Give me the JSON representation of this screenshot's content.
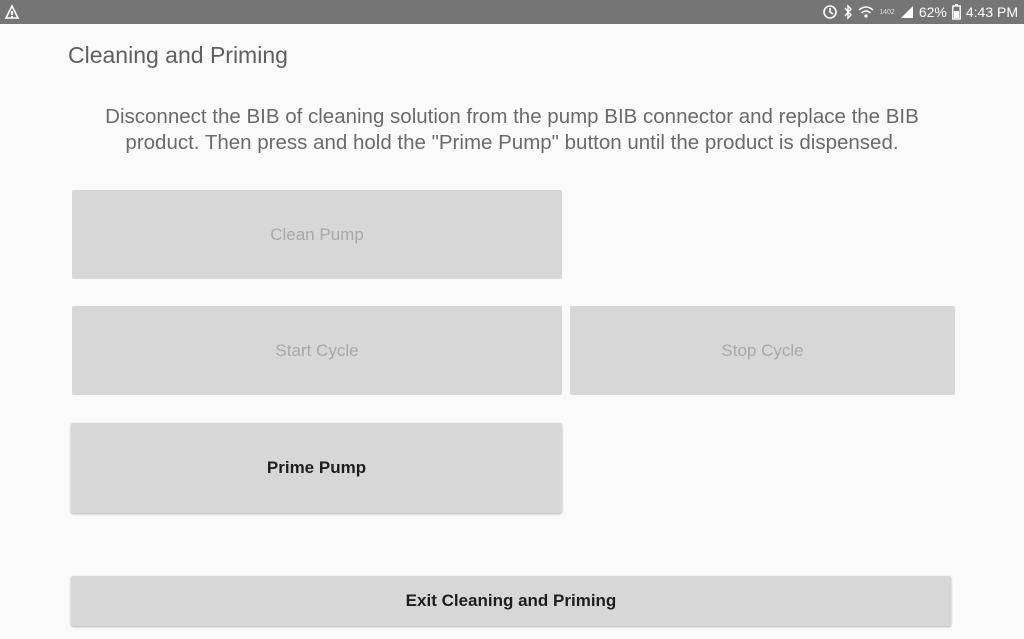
{
  "status_bar": {
    "left_icon": "notification-icon",
    "icons": [
      "sync-icon",
      "bluetooth-icon",
      "wifi-icon",
      "signal-icon"
    ],
    "network_label": "1402",
    "battery_percent": "62%",
    "battery_icon": "battery-icon",
    "time": "4:43 PM"
  },
  "page": {
    "title": "Cleaning and Priming",
    "instructions": "Disconnect the BIB of cleaning solution from the pump BIB connector and replace the  BIB\nproduct.  Then press and hold the \"Prime  Pump\" button until the  product is dispensed."
  },
  "buttons": {
    "clean_pump": "Clean Pump",
    "start_cycle": "Start Cycle",
    "stop_cycle": "Stop Cycle",
    "prime_pump": "Prime Pump",
    "exit": "Exit Cleaning and Priming"
  },
  "colors": {
    "status_bar": "#757575",
    "background": "#fafafa",
    "button_bg": "#d7d7d7",
    "disabled_text": "#a8a8a8",
    "enabled_text": "#1e1e1e"
  }
}
